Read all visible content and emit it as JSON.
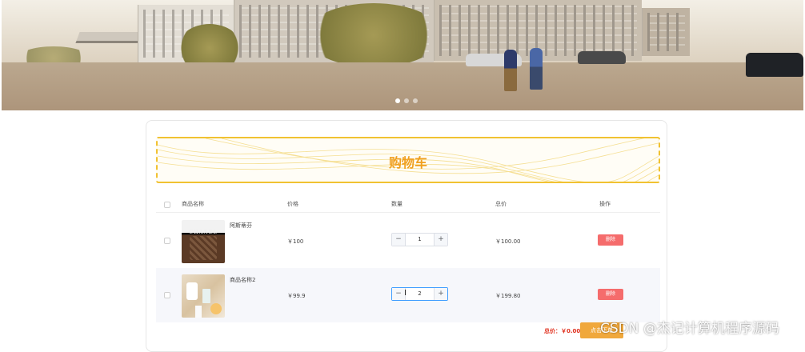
{
  "banner": {
    "slides": 3,
    "active_index": 0
  },
  "cart": {
    "title": "购物车",
    "columns": {
      "name": "商品名称",
      "price": "价格",
      "quantity": "数量",
      "total": "总价",
      "action": "操作"
    },
    "items": [
      {
        "name": "阿斯蒂芬",
        "image": "handbag-image",
        "image_text": "CHANEL",
        "price": "￥100",
        "quantity": "1",
        "total": "￥100.00",
        "delete_label": "删除"
      },
      {
        "name": "商品名称2",
        "image": "cosmetics-image",
        "price": "￥99.9",
        "quantity": "2",
        "total": "￥199.80",
        "delete_label": "删除"
      }
    ],
    "stepper": {
      "minus": "−",
      "plus": "+"
    },
    "grand_total": "总价：￥0.00",
    "checkout_label": "点击下单"
  },
  "watermark": "CSDN @杰记计算机程序源码",
  "colors": {
    "accent": "#f0a020",
    "delete": "#f56c6c",
    "checkout": "#f0a83c",
    "total": "#e0301e"
  }
}
